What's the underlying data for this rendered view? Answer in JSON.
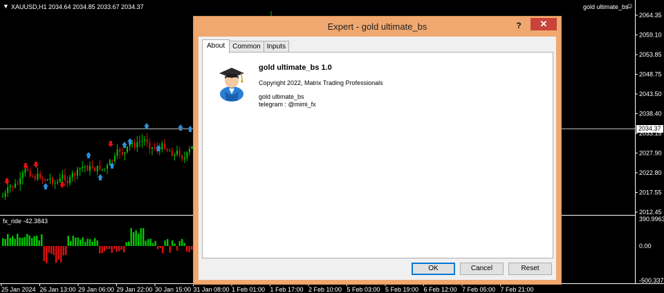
{
  "chart": {
    "symbol_info": "XAUUSD,H1  2034.64 2034.85 2033.67 2034.37",
    "ea_name": "gold ultimate_bs",
    "smiley": "☺",
    "price_labels": [
      "2064.35",
      "2059.10",
      "2053.85",
      "2048.75",
      "2043.50",
      "2038.40",
      "2033.15",
      "2027.90",
      "2022.80",
      "2017.55",
      "2012.45"
    ],
    "current_price": "2034.37",
    "indicator_label": "fx_ride -42.3843",
    "indicator_levels": [
      "390.9963",
      "0.00",
      "-500.3375"
    ],
    "time_labels": [
      "25 Jan 2024",
      "26 Jan 13:00",
      "29 Jan 06:00",
      "29 Jan 22:00",
      "30 Jan 15:00",
      "31 Jan 08:00",
      "1 Feb 01:00",
      "1 Feb 17:00",
      "2 Feb 10:00",
      "5 Feb 03:00",
      "5 Feb 19:00",
      "6 Feb 12:00",
      "7 Feb 05:00",
      "7 Feb 21:00"
    ],
    "colors": {
      "up_candle": "#00c800",
      "down_candle": "#e01010",
      "buy_arrow": "#2f8fd8",
      "sell_arrow": "#e01010",
      "hist_up": "#00c800",
      "hist_down": "#e01010"
    }
  },
  "dialog": {
    "title": "Expert - gold ultimate_bs",
    "help_label": "?",
    "close_label": "✕",
    "tabs": [
      {
        "label": "About",
        "active": true
      },
      {
        "label": "Common",
        "active": false
      },
      {
        "label": "Inputs",
        "active": false
      }
    ],
    "about": {
      "icon": "graduate-icon",
      "name_version": "gold ultimate_bs  1.0",
      "copyright": "Copyright 2022, Matrix Trading Professionals",
      "description_lines": [
        "gold ultimate_bs",
        "telegram : @mimi_fx"
      ]
    },
    "buttons": {
      "ok": "OK",
      "cancel": "Cancel",
      "reset": "Reset"
    }
  }
}
